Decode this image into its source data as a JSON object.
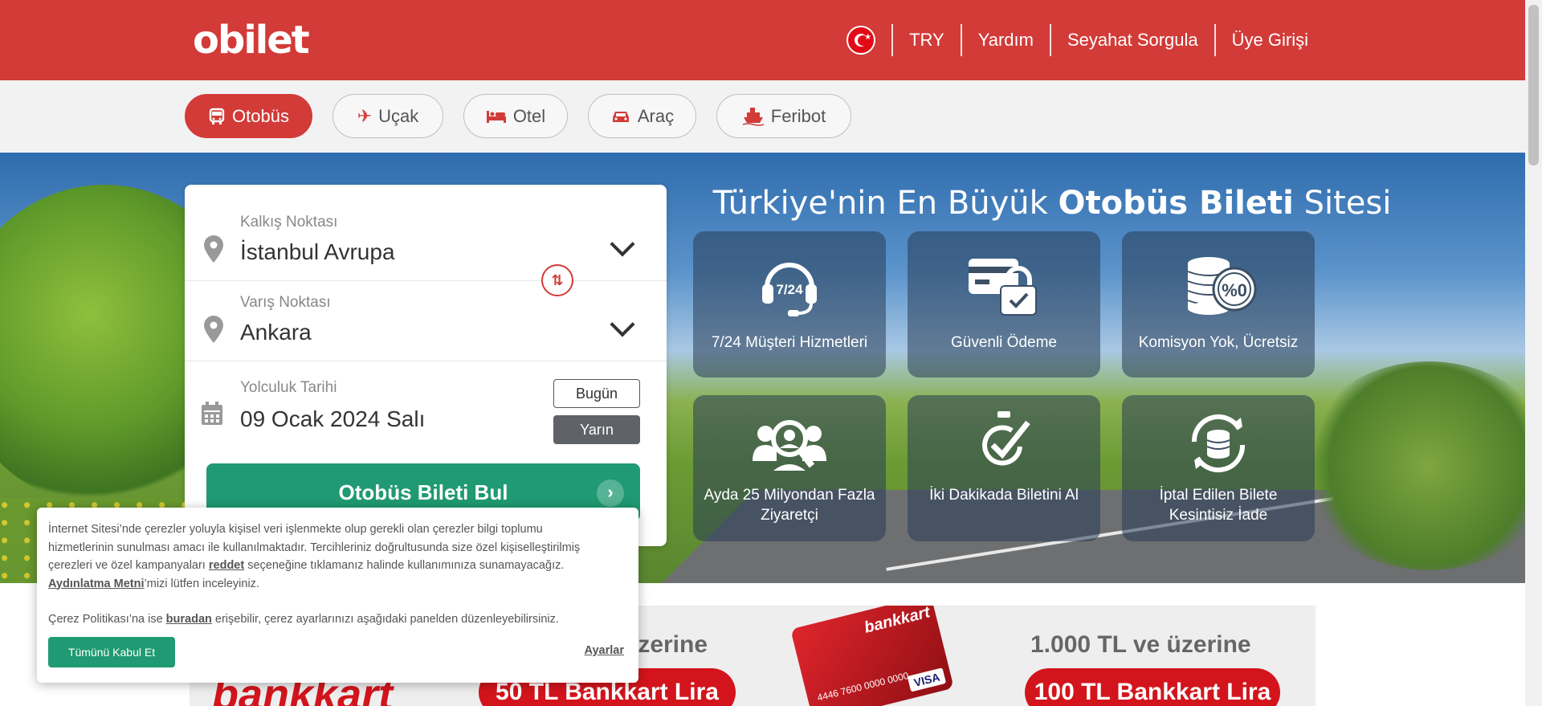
{
  "header": {
    "logo": "obilet",
    "flag_icon": "turkey-flag-icon",
    "currency": "TRY",
    "links": [
      "Yardım",
      "Seyahat Sorgula",
      "Üye Girişi"
    ]
  },
  "tabs": [
    {
      "label": "Otobüs",
      "icon": "bus-icon",
      "active": true
    },
    {
      "label": "Uçak",
      "icon": "plane-icon",
      "active": false
    },
    {
      "label": "Otel",
      "icon": "bed-icon",
      "active": false
    },
    {
      "label": "Araç",
      "icon": "car-icon",
      "active": false
    },
    {
      "label": "Feribot",
      "icon": "ferry-icon",
      "active": false
    }
  ],
  "search": {
    "origin_label": "Kalkış Noktası",
    "origin_value": "İstanbul Avrupa",
    "destination_label": "Varış Noktası",
    "destination_value": "Ankara",
    "date_label": "Yolculuk Tarihi",
    "date_value": "09 Ocak 2024 Salı",
    "today_label": "Bugün",
    "tomorrow_label": "Yarın",
    "submit_label": "Otobüs Bileti Bul"
  },
  "hero": {
    "title_pre": "Türkiye'nin En Büyük ",
    "title_bold": "Otobüs Bileti",
    "title_post": " Sitesi",
    "features": [
      {
        "label": "7/24 Müşteri Hizmetleri",
        "icon": "headset-icon",
        "icon_text": "7/24"
      },
      {
        "label": "Güvenli Ödeme",
        "icon": "secure-card-icon"
      },
      {
        "label": "Komisyon Yok, Ücretsiz",
        "icon": "coins-icon",
        "icon_text": "%0"
      },
      {
        "label": "Ayda 25 Milyondan Fazla Ziyaretçi",
        "icon": "visitors-icon"
      },
      {
        "label": "İki Dakikada Biletini Al",
        "icon": "stopwatch-check-icon"
      },
      {
        "label": "İptal Edilen Bilete Kesintisiz İade",
        "icon": "refund-icon"
      }
    ]
  },
  "banner": {
    "brand": "bankkart",
    "card_brand": "bankkart",
    "card_number": "4446 7600 0000 0000",
    "card_network": "VISA",
    "left_text": "üzerine",
    "left_pill": "50 TL Bankkart Lira",
    "right_text": "1.000 TL ve üzerine",
    "right_pill": "100 TL Bankkart Lira"
  },
  "cookie": {
    "line1": "İnternet Sitesi’nde çerezler yoluyla kişisel veri işlenmekte olup gerekli olan çerezler bilgi toplumu",
    "line2": "hizmetlerinin sunulması amacı ile kullanılmaktadır. Tercihleriniz doğrultusunda size özel kişiselleştirilmiş",
    "line3_pre": "çerezleri ve özel kampanyaları ",
    "line3_link": "reddet",
    "line3_post": " seçeneğine tıklamanız halinde kullanımınıza sunamayacağız.",
    "line4_link": "Aydınlatma Metni",
    "line4_post": "’mizi lütfen inceleyiniz.",
    "line5_pre": "Çerez Politikası’na ise ",
    "line5_link": "buradan",
    "line5_post": " erişebilir, çerez ayarlarınızı aşağıdaki panelden düzenleyebilirsiniz.",
    "accept_label": "Tümünü Kabul Et",
    "settings_label": "Ayarlar"
  }
}
